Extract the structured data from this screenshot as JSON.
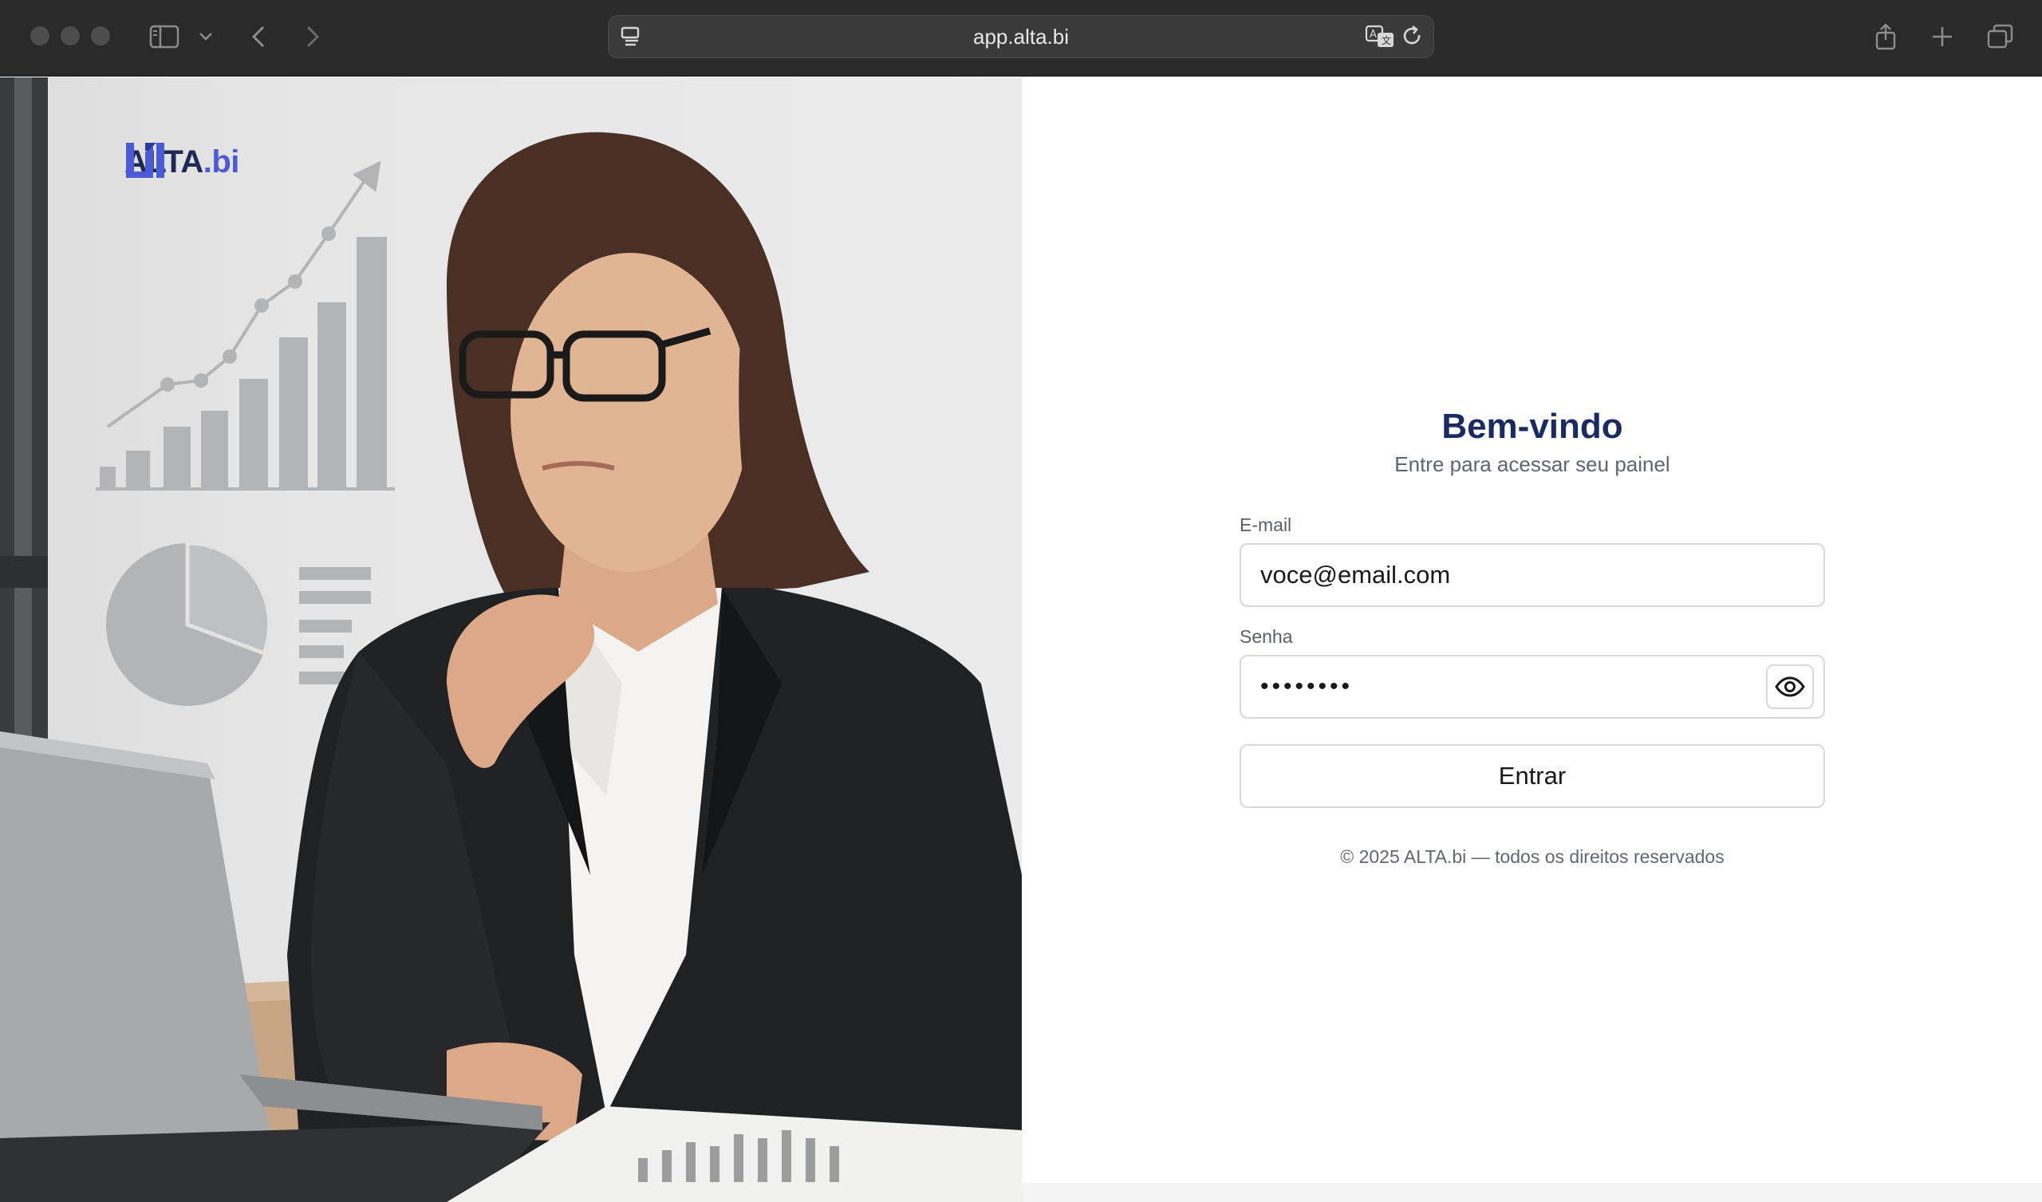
{
  "browser": {
    "url": "app.alta.bi"
  },
  "brand": {
    "logo_main": "ALTA",
    "logo_accent": ".bi",
    "color_primary": "#1a2b63",
    "color_accent": "#4d5ad6"
  },
  "login": {
    "title": "Bem-vindo",
    "subtitle": "Entre para acessar seu painel",
    "email_label": "E-mail",
    "email_value": "voce@email.com",
    "password_label": "Senha",
    "password_masked": "••••••••",
    "submit_label": "Entrar",
    "footer": "© 2025 ALTA.bi — todos os direitos reservados"
  },
  "icons": {
    "show_password": "eye-icon",
    "sidebar": "sidebar-icon",
    "back": "chevron-left-icon",
    "forward": "chevron-right-icon",
    "share": "share-icon",
    "new_tab": "plus-icon",
    "tabs": "tabs-overview-icon"
  }
}
